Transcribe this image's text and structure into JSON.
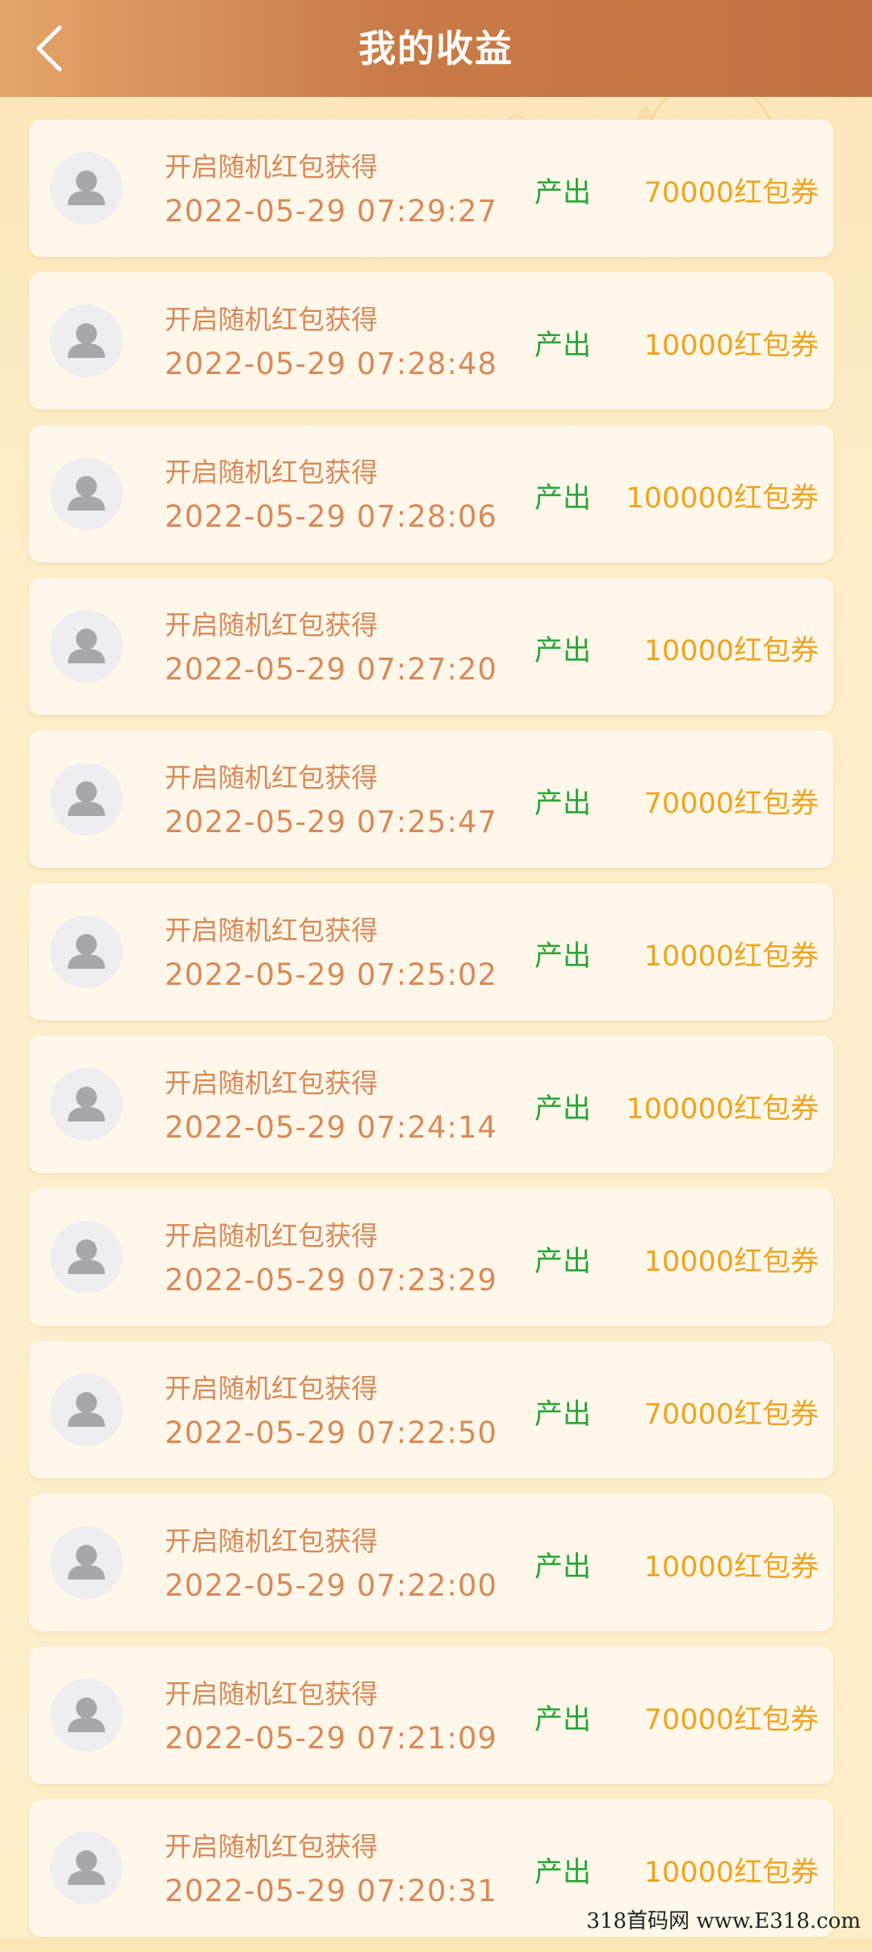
{
  "header": {
    "title": "我的收益"
  },
  "records": [
    {
      "title": "开启随机红包获得",
      "time": "2022-05-29  07:29:27",
      "tag": "产出",
      "amount": "70000红包券"
    },
    {
      "title": "开启随机红包获得",
      "time": "2022-05-29  07:28:48",
      "tag": "产出",
      "amount": "10000红包券"
    },
    {
      "title": "开启随机红包获得",
      "time": "2022-05-29  07:28:06",
      "tag": "产出",
      "amount": "100000红包券"
    },
    {
      "title": "开启随机红包获得",
      "time": "2022-05-29  07:27:20",
      "tag": "产出",
      "amount": "10000红包券"
    },
    {
      "title": "开启随机红包获得",
      "time": "2022-05-29  07:25:47",
      "tag": "产出",
      "amount": "70000红包券"
    },
    {
      "title": "开启随机红包获得",
      "time": "2022-05-29  07:25:02",
      "tag": "产出",
      "amount": "10000红包券"
    },
    {
      "title": "开启随机红包获得",
      "time": "2022-05-29  07:24:14",
      "tag": "产出",
      "amount": "100000红包券"
    },
    {
      "title": "开启随机红包获得",
      "time": "2022-05-29  07:23:29",
      "tag": "产出",
      "amount": "10000红包券"
    },
    {
      "title": "开启随机红包获得",
      "time": "2022-05-29  07:22:50",
      "tag": "产出",
      "amount": "70000红包券"
    },
    {
      "title": "开启随机红包获得",
      "time": "2022-05-29  07:22:00",
      "tag": "产出",
      "amount": "10000红包券"
    },
    {
      "title": "开启随机红包获得",
      "time": "2022-05-29  07:21:09",
      "tag": "产出",
      "amount": "70000红包券"
    },
    {
      "title": "开启随机红包获得",
      "time": "2022-05-29  07:20:31",
      "tag": "产出",
      "amount": "10000红包券"
    }
  ],
  "watermark": "318首码网 www.E318.com",
  "icons": {
    "back": "chevron-left-icon",
    "avatar": "default-user-icon"
  },
  "colors": {
    "header_start": "#e3a56a",
    "header_end": "#c27240",
    "text_brown": "#d9895a",
    "tag_green": "#2aa53a",
    "amount_orange": "#f0a320",
    "card_bg": "#fff8ea"
  }
}
